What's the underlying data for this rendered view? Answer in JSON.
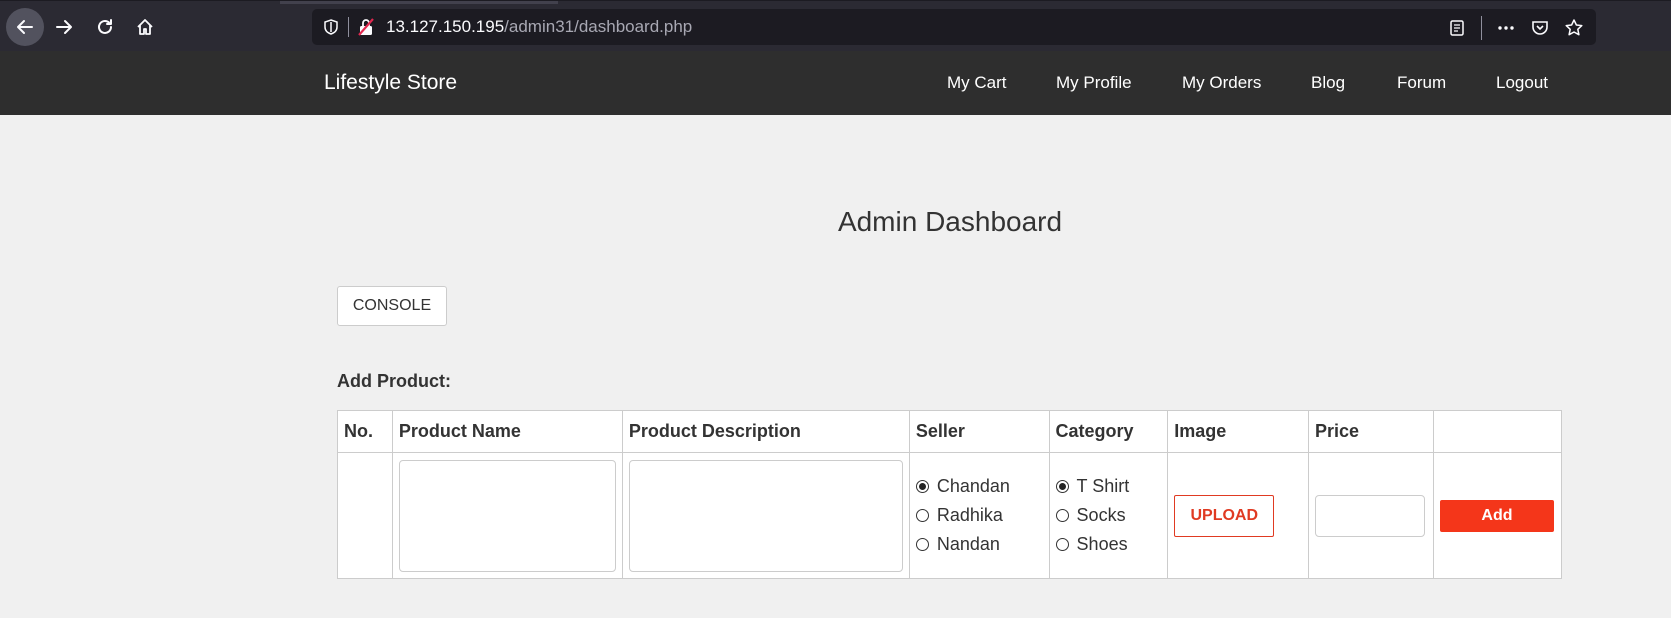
{
  "browser": {
    "url_host": "13.127.150.195",
    "url_path": "/admin31/dashboard.php",
    "icons": [
      "back-icon",
      "forward-icon",
      "reload-icon",
      "home-icon",
      "shield-icon",
      "insecure-lock-icon",
      "reader-view-icon",
      "more-icon",
      "pocket-icon",
      "bookmark-star-icon"
    ]
  },
  "navbar": {
    "brand": "Lifestyle Store",
    "links": [
      {
        "label": "My Cart"
      },
      {
        "label": "My Profile"
      },
      {
        "label": "My Orders"
      },
      {
        "label": "Blog"
      },
      {
        "label": "Forum"
      },
      {
        "label": "Logout"
      }
    ]
  },
  "main": {
    "title": "Admin Dashboard",
    "console_label": "CONSOLE",
    "add_product_label": "Add Product:",
    "table": {
      "headers": [
        "No.",
        "Product Name",
        "Product Description",
        "Seller",
        "Category",
        "Image",
        "Price",
        ""
      ],
      "sellers": [
        {
          "label": "Chandan",
          "checked": true
        },
        {
          "label": "Radhika",
          "checked": false
        },
        {
          "label": "Nandan",
          "checked": false
        }
      ],
      "categories": [
        {
          "label": "T Shirt",
          "checked": true
        },
        {
          "label": "Socks",
          "checked": false
        },
        {
          "label": "Shoes",
          "checked": false
        }
      ],
      "upload_label": "UPLOAD",
      "add_label": "Add"
    }
  },
  "colors": {
    "navbar_bg": "#2e2e2e",
    "accent": "#f4361a",
    "page_bg": "#f0f0f0"
  }
}
